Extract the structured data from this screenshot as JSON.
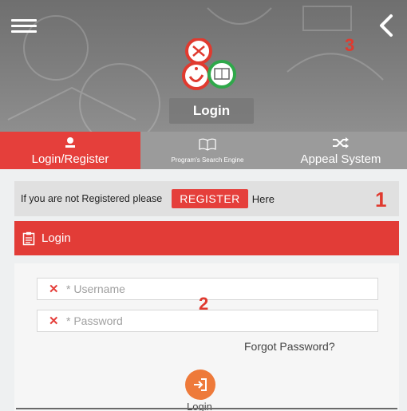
{
  "header": {
    "title": "Login",
    "menu_icon": "hamburger-menu-icon",
    "back_icon": "chevron-left-icon",
    "logo_icon": "three-circles-logo"
  },
  "tabs": [
    {
      "label": "Login/Register",
      "icon": "user-icon",
      "active": true
    },
    {
      "label": "Program's Search Engine",
      "icon": "book-icon",
      "active": false
    },
    {
      "label": "Appeal System",
      "icon": "shuffle-icon",
      "active": false
    }
  ],
  "register_bar": {
    "prefix": "If you are not Registered please",
    "button": "REGISTER",
    "suffix": "Here"
  },
  "login_panel": {
    "title": "Login",
    "icon": "clipboard-icon",
    "username_placeholder": "* Username",
    "password_placeholder": "* Password",
    "forgot": "Forgot Password?",
    "login_button_label": "Login",
    "login_icon": "sign-in-icon"
  },
  "annotations": [
    "1",
    "2",
    "3"
  ],
  "colors": {
    "accent": "#e53f3b",
    "tab_inactive": "#9b9b9b",
    "login_button": "#ee7a3a",
    "logo_green": "#2fa84a"
  }
}
